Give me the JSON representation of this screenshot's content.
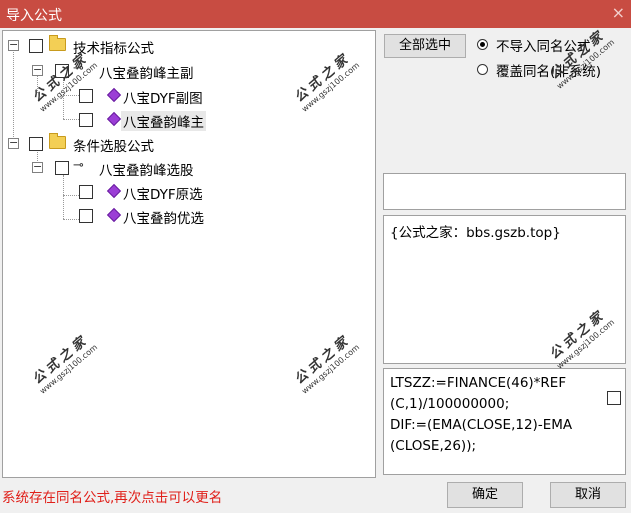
{
  "window": {
    "title": "导入公式",
    "close_glyph": "×"
  },
  "tree": {
    "groups": [
      {
        "label": "技术指标公式",
        "formulas": [
          {
            "label": "八宝叠韵峰主副",
            "children": [
              "八宝DYF副图",
              "八宝叠韵峰主"
            ]
          }
        ]
      },
      {
        "label": "条件选股公式",
        "formulas": [
          {
            "label": "八宝叠韵峰选股",
            "children": [
              "八宝DYF原选",
              "八宝叠韵优选"
            ]
          }
        ]
      }
    ],
    "selected_item": "八宝叠韵峰主"
  },
  "watermark": {
    "text": "公式之家",
    "url": "www.gszj100.com"
  },
  "options": {
    "select_all_label": "全部选中",
    "radio_options": [
      {
        "label": "不导入同名公式",
        "selected": true
      },
      {
        "label": "覆盖同名(非系统)",
        "selected": false
      }
    ]
  },
  "info": {
    "description": "{公式之家：bbs.gszb.top}",
    "code_lines": [
      "LTSZZ:=FINANCE(46)*REF",
      "(C,1)/100000000;",
      "DIF:=(EMA(CLOSE,12)-EMA",
      "(CLOSE,26));"
    ]
  },
  "footer": {
    "status": "系统存在同名公式,再次点击可以更名",
    "ok_label": "确定",
    "cancel_label": "取消"
  },
  "colors": {
    "titlebar": "#c84c42",
    "status_text": "#e0201a"
  }
}
